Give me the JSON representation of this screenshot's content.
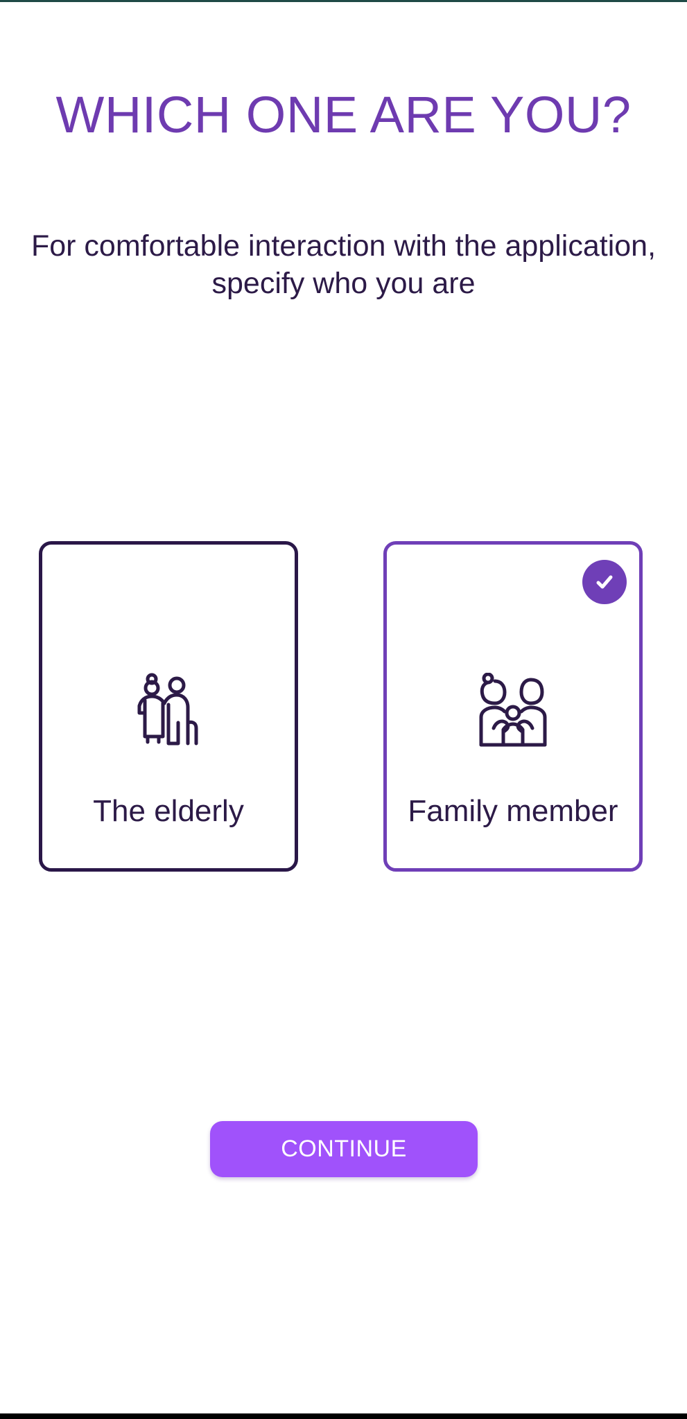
{
  "header": {
    "title": "WHICH ONE ARE YOU?",
    "subtitle": "For comfortable interaction with the application, specify who you are"
  },
  "options": [
    {
      "label": "The elderly",
      "icon": "elderly-couple-icon",
      "selected": false
    },
    {
      "label": "Family member",
      "icon": "family-icon",
      "selected": true
    }
  ],
  "actions": {
    "continue_label": "CONTINUE"
  },
  "colors": {
    "accent": "#6f3fb7",
    "title": "#6e3bb0",
    "text": "#2c1a47",
    "button": "#a052fb",
    "card_border_unselected": "#2a1748"
  }
}
